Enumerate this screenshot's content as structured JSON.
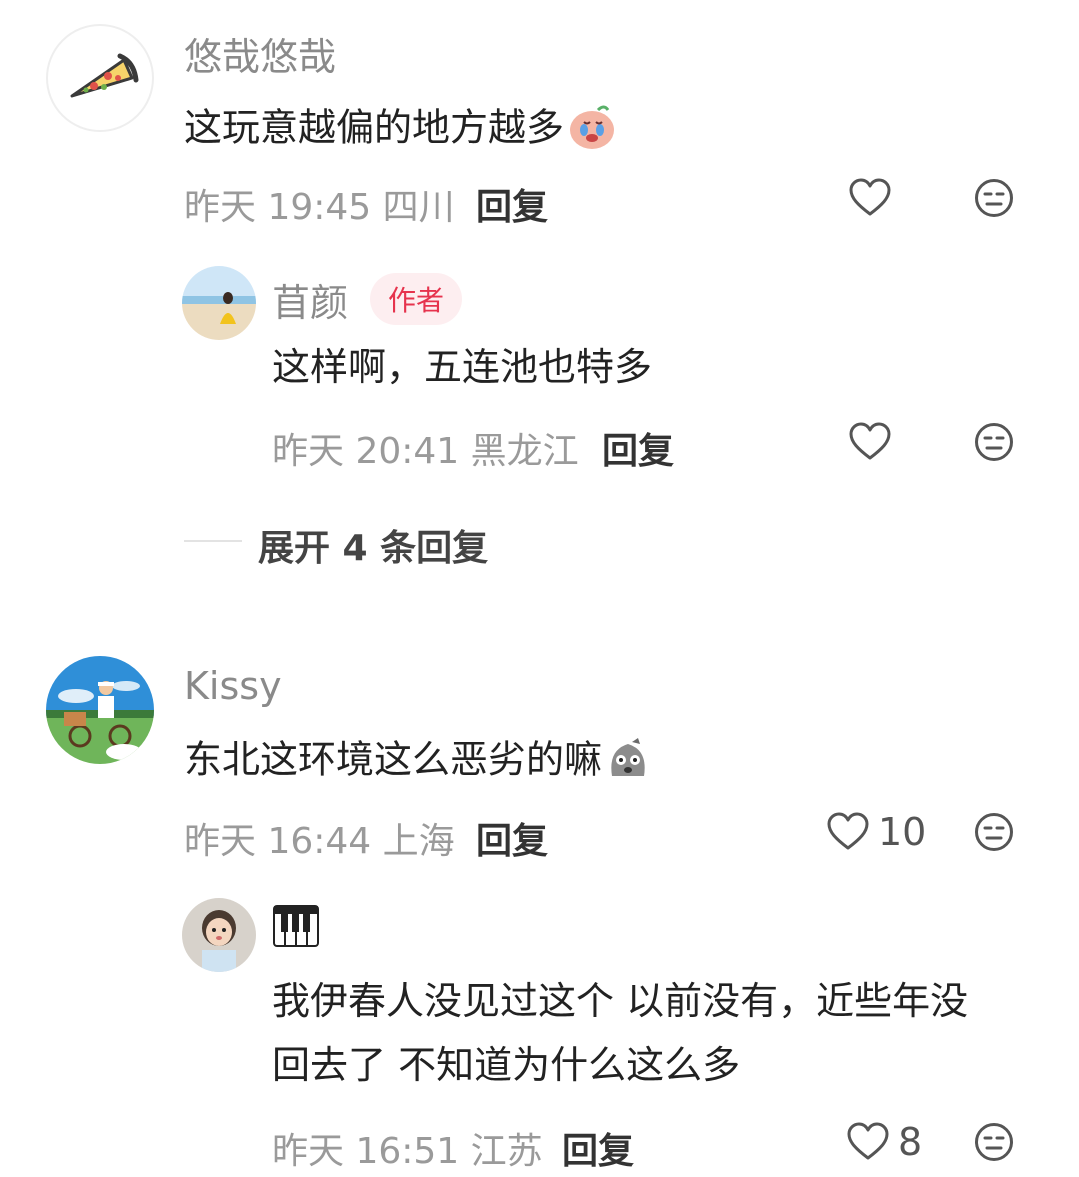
{
  "comments": [
    {
      "username": "悠哉悠哉",
      "avatar_icon": "pizza-icon",
      "content": "这玩意越偏的地方越多",
      "emoji": "crying-face-emoji",
      "time": "昨天 19:45",
      "location": "四川",
      "reply_label": "回复",
      "like_count": "",
      "replies": [
        {
          "username": "苜颜",
          "badge": "作者",
          "avatar_icon": "beach-photo-avatar",
          "content": "这样啊，五连池也特多",
          "time": "昨天 20:41",
          "location": "黑龙江",
          "reply_label": "回复",
          "like_count": ""
        }
      ],
      "expand_label": "展开 4 条回复"
    },
    {
      "username": "Kissy",
      "avatar_icon": "cyclist-illustration-avatar",
      "content": "东北这环境这么恶劣的嘛",
      "emoji": "shocked-face-emoji",
      "time": "昨天 16:44",
      "location": "上海",
      "reply_label": "回复",
      "like_count": "10",
      "replies": [
        {
          "username": "🎹",
          "avatar_icon": "child-photo-avatar",
          "content_line1": "我伊春人没见过这个 以前没有，近些年没",
          "content_line2": "回去了 不知道为什么这么多",
          "time": "昨天 16:51",
          "location": "江苏",
          "reply_label": "回复",
          "like_count": "8"
        }
      ]
    }
  ],
  "colors": {
    "author_badge_bg": "#fdeef0",
    "author_badge_text": "#e6334d",
    "meta_text": "#9a9a9a",
    "username_text": "#8a8a8a"
  }
}
